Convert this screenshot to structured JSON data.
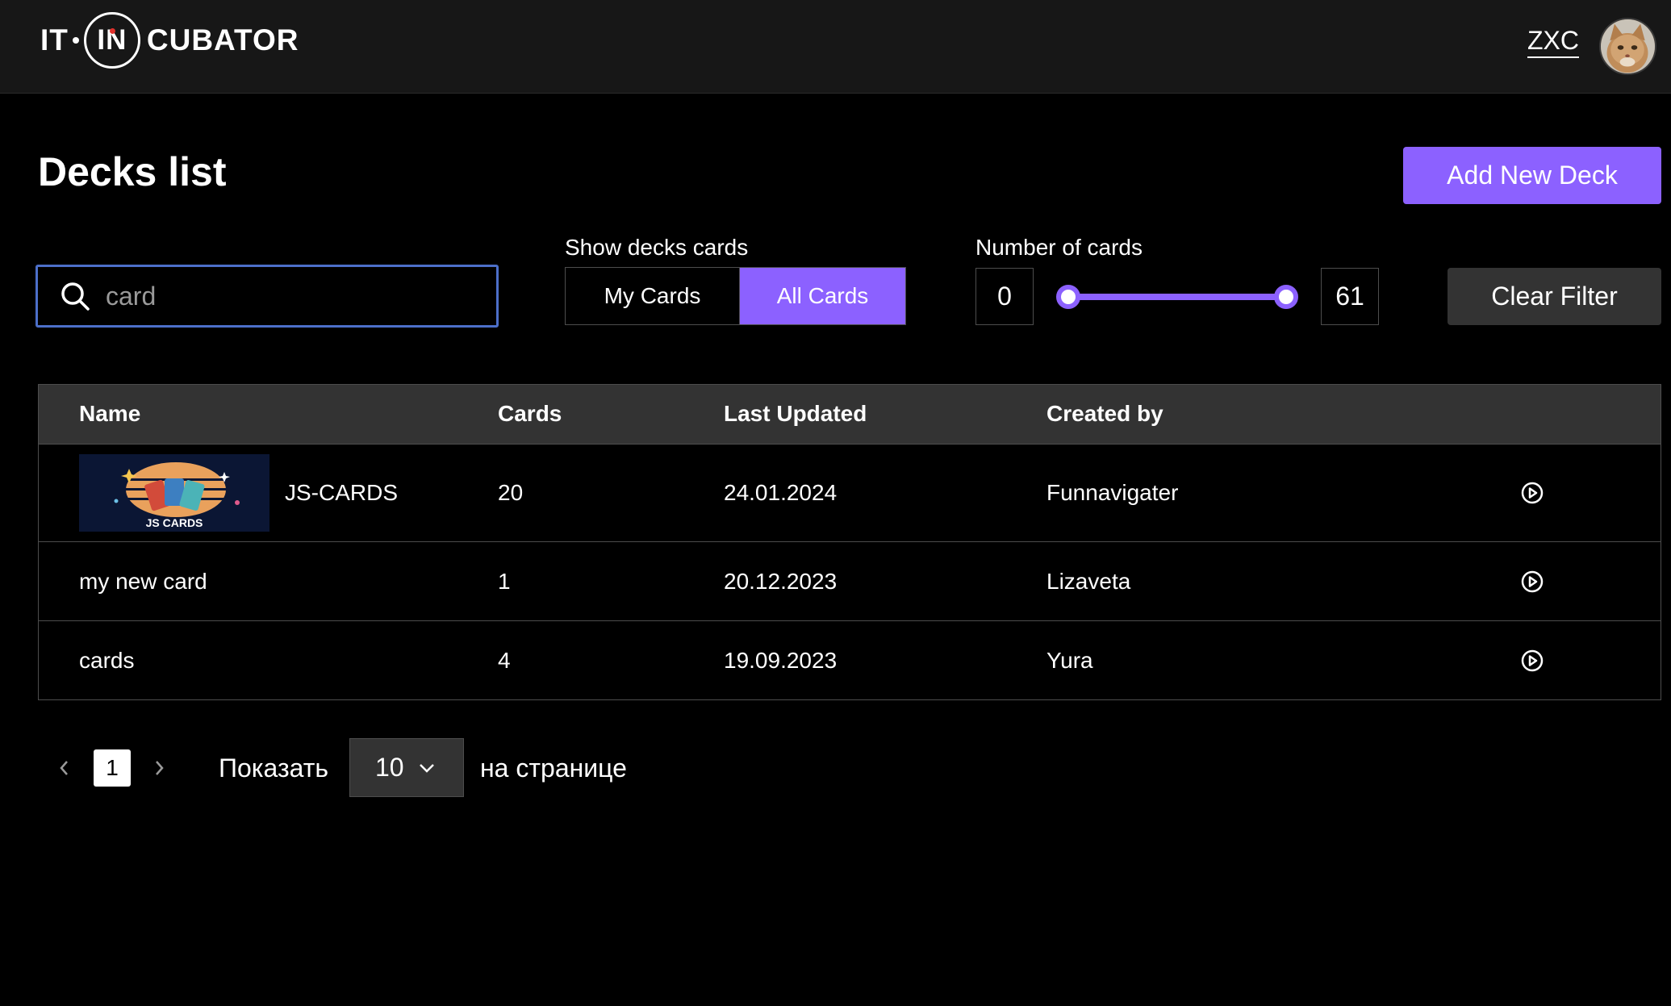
{
  "header": {
    "logo_part1": "IT",
    "logo_part2": "IN",
    "logo_part3": "CUBATOR",
    "user_name": "ZXC"
  },
  "page": {
    "title": "Decks list",
    "add_button": "Add New Deck"
  },
  "filters": {
    "search_value": "card",
    "show_label": "Show decks cards",
    "toggle_my": "My Cards",
    "toggle_all": "All Cards",
    "toggle_selected": "All Cards",
    "number_label": "Number of cards",
    "min_value": "0",
    "max_value": "61",
    "clear_button": "Clear Filter"
  },
  "table": {
    "columns": [
      "Name",
      "Cards",
      "Last Updated",
      "Created by"
    ],
    "rows": [
      {
        "name": "JS-CARDS",
        "cards": "20",
        "updated": "24.01.2024",
        "author": "Funnavigater",
        "has_cover": true
      },
      {
        "name": "my new card",
        "cards": "1",
        "updated": "20.12.2023",
        "author": "Lizaveta",
        "has_cover": false
      },
      {
        "name": "cards",
        "cards": "4",
        "updated": "19.09.2023",
        "author": "Yura",
        "has_cover": false
      }
    ]
  },
  "cover_label": "JS CARDS",
  "pagination": {
    "current_page": "1",
    "show_label": "Показать",
    "page_size": "10",
    "per_page_label": "на странице"
  },
  "colors": {
    "accent": "#8c61ff",
    "background": "#000000",
    "header_bg": "#171717",
    "table_header_bg": "#333333",
    "focus_border": "#4c6fc9"
  },
  "icons": [
    "search-icon",
    "play-circle-icon",
    "chevron-left-icon",
    "chevron-right-icon",
    "chevron-down-icon"
  ]
}
